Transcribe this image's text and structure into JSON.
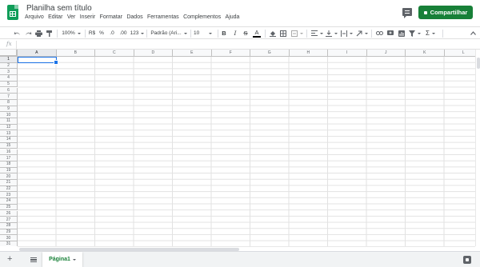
{
  "header": {
    "title": "Planilha sem título",
    "menu": [
      "Arquivo",
      "Editar",
      "Ver",
      "Inserir",
      "Formatar",
      "Dados",
      "Ferramentas",
      "Complementos",
      "Ajuda"
    ],
    "share_label": "Compartilhar",
    "accent_color": "#188038"
  },
  "toolbar": {
    "zoom": "100%",
    "currency": "R$",
    "percent": "%",
    "decimal_less": ".0",
    "decimal_more": ".00",
    "more_formats": "123",
    "font": "Padrão (Ari...",
    "font_size": "10",
    "bold": "B",
    "italic": "I",
    "strikethrough": "S",
    "text_color": "A",
    "functions": "Σ"
  },
  "formula_bar": {
    "fx": "fx",
    "value": ""
  },
  "grid": {
    "columns": [
      "A",
      "B",
      "C",
      "D",
      "E",
      "F",
      "G",
      "H",
      "I",
      "J",
      "K",
      "L"
    ],
    "rows": [
      "1",
      "2",
      "3",
      "4",
      "5",
      "6",
      "7",
      "8",
      "9",
      "10",
      "11",
      "12",
      "13",
      "14",
      "15",
      "16",
      "17",
      "18",
      "19",
      "20",
      "21",
      "22",
      "23",
      "24",
      "25",
      "26",
      "27",
      "28",
      "29",
      "30",
      "31"
    ],
    "selected_cell": "A1"
  },
  "sheets": {
    "tabs": [
      {
        "label": "Página1"
      }
    ]
  }
}
